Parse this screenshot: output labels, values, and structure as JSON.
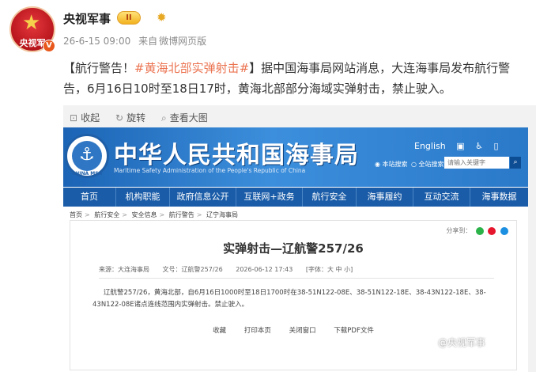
{
  "post": {
    "author": "央视军事",
    "avatar_text": "央视军",
    "verify_mark": "V",
    "badge_label": "II",
    "time": "26-6-15 09:00",
    "source_prefix": "来自",
    "source": "微博网页版",
    "text_part1": "【航行警告！",
    "hashtag": "#黄海北部实弹射击#",
    "text_part2": "】据中国海事局网站消息，大连海事局发布航行警告，6月16日10时至18日17时，黄海北部部分海域实弹射击，禁止驶入。"
  },
  "image_toolbar": {
    "collapse": "收起",
    "rotate": "旋转",
    "view_large": "查看大图"
  },
  "msa": {
    "logo_text": "CHINA MSA",
    "title": "中华人民共和国海事局",
    "subtitle": "Maritime Safety Administration of the People's Republic of China",
    "english_link": "English",
    "radio_site": "本站搜索",
    "radio_all": "全站搜索",
    "search_placeholder": "请输入关键字",
    "nav": [
      "首页",
      "机构职能",
      "政府信息公开",
      "互联网+政务",
      "航行安全",
      "海事履约",
      "互动交流",
      "海事数据"
    ],
    "breadcrumb": [
      "首页",
      "航行安全",
      "安全信息",
      "航行警告",
      "辽宁海事局"
    ]
  },
  "article": {
    "share_label": "分享到：",
    "title": "实弹射击—辽航警257/26",
    "source": "来源：大连海事局",
    "number": "文号：辽航警257/26",
    "date": "2026-06-12 17:43",
    "font_size": "[字体：大 中 小]",
    "body": "辽航警257/26，黄海北部，自6月16日1000时至18日1700时在38-51N122-08E、38-51N122-18E、38-43N122-18E、38-43N122-08E诸点连线范围内实弹射击。禁止驶入。",
    "actions": [
      "收藏",
      "打印本页",
      "关闭窗口",
      "下载PDF文件"
    ]
  },
  "watermark": "@央视军事"
}
